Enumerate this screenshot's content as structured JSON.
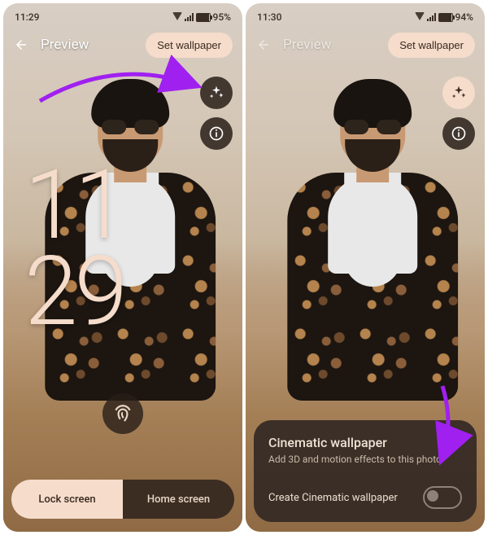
{
  "left": {
    "status": {
      "time": "11:29",
      "battery": "95%"
    },
    "header": {
      "title": "Preview",
      "set_wallpaper": "Set wallpaper"
    },
    "clock": {
      "hour": "11",
      "minute": "29"
    },
    "tabs": {
      "lock": "Lock screen",
      "home": "Home screen"
    },
    "icons": {
      "back": "back-icon",
      "sparkles": "sparkles-icon",
      "info": "info-icon",
      "fingerprint": "fingerprint-icon"
    }
  },
  "right": {
    "status": {
      "time": "11:30",
      "battery": "94%"
    },
    "header": {
      "title": "Preview",
      "set_wallpaper": "Set wallpaper"
    },
    "sheet": {
      "title": "Cinematic wallpaper",
      "subtitle": "Add 3D and motion effects to this photo",
      "toggle_label": "Create Cinematic wallpaper"
    },
    "icons": {
      "back": "back-icon",
      "sparkles": "sparkles-icon",
      "info": "info-icon"
    }
  },
  "colors": {
    "accent": "#f5dccb",
    "annotation": "#a020f0"
  }
}
